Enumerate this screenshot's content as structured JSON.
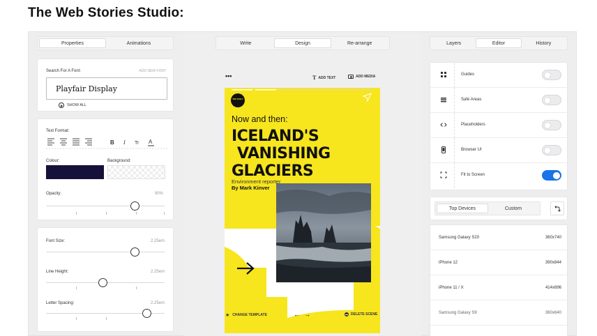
{
  "page_title": "The Web Stories Studio:",
  "left_panel": {
    "tabs": [
      {
        "label": "Properties",
        "active": true
      },
      {
        "label": "Animations",
        "active": false
      }
    ],
    "font_search": {
      "label": "Search For A Font:",
      "add_label": "ADD NEW FONT",
      "value": "Playfair Display",
      "show_all": "SHOW ALL"
    },
    "text_format": {
      "label": "Text Format:"
    },
    "colour": {
      "label": "Colour:",
      "value": "#15113a"
    },
    "background": {
      "label": "Background:"
    },
    "opacity": {
      "label": "Opacity:",
      "value": "90%",
      "level": 0.9
    },
    "font_size": {
      "label": "Font Size:",
      "value": "2.25em"
    },
    "line_height": {
      "label": "Line Height:",
      "value": "2.25em"
    },
    "letter_spacing": {
      "label": "Letter Spacing:",
      "value": "2.25em"
    }
  },
  "middle_panel": {
    "tabs": [
      {
        "label": "Write",
        "active": false
      },
      {
        "label": "Design",
        "active": true
      },
      {
        "label": "Re-arrange",
        "active": false
      }
    ],
    "toolbar": {
      "more": "•••",
      "add_text": "ADD TEXT",
      "add_media": "ADD MEDIA"
    },
    "story": {
      "logo_text": "THE DAILY",
      "kicker": "Now and then:",
      "headline": [
        "ICELAND'S",
        "VANISHING",
        "GLACIERS"
      ],
      "byline_role": "Environment reporter",
      "byline_name": "By Mark Kinver",
      "accent_color": "#f7e51e"
    },
    "bottom_bar": {
      "change_template": "CHANGE TEMPLATE",
      "delete_scene": "DELETE SCENE"
    }
  },
  "right_panel": {
    "tabs": [
      {
        "label": "Layers",
        "active": false
      },
      {
        "label": "Editor",
        "active": true
      },
      {
        "label": "History",
        "active": false
      }
    ],
    "options": [
      {
        "name": "Guides",
        "icon": "grid-icon",
        "on": false
      },
      {
        "name": "Safe Areas",
        "icon": "safe-area-icon",
        "on": false
      },
      {
        "name": "Placeholders",
        "icon": "code-icon",
        "on": false
      },
      {
        "name": "Browser UI",
        "icon": "phone-icon",
        "on": false
      },
      {
        "name": "Fit to Screen",
        "icon": "fit-screen-icon",
        "on": true
      }
    ],
    "device_tabs": [
      {
        "label": "Top Devices",
        "active": true
      },
      {
        "label": "Custom",
        "active": false
      }
    ],
    "devices": [
      {
        "name": "Samsung Galaxy S20",
        "res": "360x740"
      },
      {
        "name": "iPhone 12",
        "res": "390x844"
      },
      {
        "name": "iPhone 11 / X",
        "res": "414x896"
      },
      {
        "name": "Samsung Galaxy S9",
        "res": "360x640"
      }
    ]
  }
}
